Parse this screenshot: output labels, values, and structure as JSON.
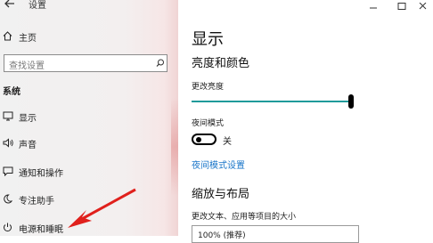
{
  "window": {
    "title": "设置",
    "back_icon": "arrow-left-icon",
    "minimize_icon": "minimize-icon",
    "maximize_icon": "maximize-icon",
    "close_icon": "close-icon"
  },
  "sidebar": {
    "home_label": "主页",
    "search_placeholder": "查找设置",
    "section_title": "系统",
    "items": [
      {
        "label": "显示",
        "icon": "monitor-icon"
      },
      {
        "label": "声音",
        "icon": "speaker-icon"
      },
      {
        "label": "通知和操作",
        "icon": "notification-icon"
      },
      {
        "label": "专注助手",
        "icon": "moon-icon"
      },
      {
        "label": "电源和睡眠",
        "icon": "power-icon"
      }
    ]
  },
  "main": {
    "page_title": "显示",
    "section_brightness": "亮度和颜色",
    "brightness_label": "更改亮度",
    "brightness_value": 1.0,
    "night_mode_label": "夜间模式",
    "night_mode_state": "关",
    "night_mode_link": "夜间模式设置",
    "section_layout": "缩放与布局",
    "scale_label": "更改文本、应用等项目的大小",
    "scale_value": "100% (推荐)"
  },
  "colors": {
    "accent": "#1f9a9a",
    "link": "#1a76c9",
    "annotation_arrow": "#e0201c"
  }
}
